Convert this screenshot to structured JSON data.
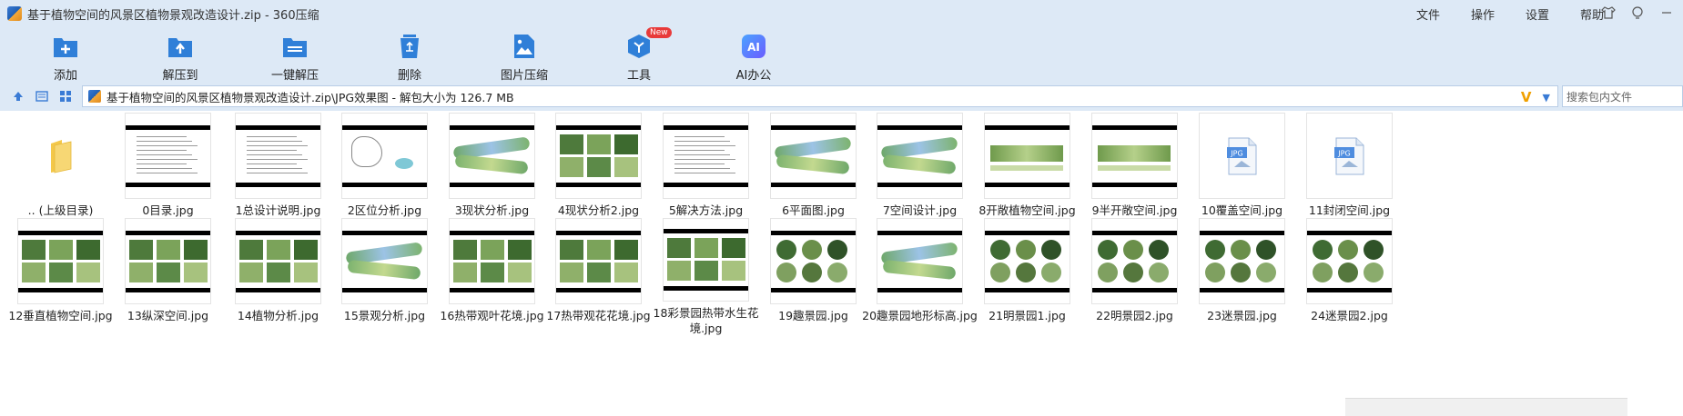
{
  "window": {
    "title": "基于植物空间的风景区植物景观改造设计.zip - 360压缩",
    "menu": [
      "文件",
      "操作",
      "设置",
      "帮助"
    ],
    "controls": [
      "skin-icon",
      "minimize-icon",
      "maximize-icon",
      "close-icon"
    ]
  },
  "toolbar": {
    "items": [
      {
        "label": "添加",
        "icon": "add-archive-icon",
        "color": "#2f7fd8"
      },
      {
        "label": "解压到",
        "icon": "extract-to-icon",
        "color": "#2f7fd8"
      },
      {
        "label": "一键解压",
        "icon": "one-click-extract-icon",
        "color": "#2f7fd8"
      },
      {
        "label": "删除",
        "icon": "recycle-icon",
        "color": "#2f7fd8"
      },
      {
        "label": "图片压缩",
        "icon": "image-compress-icon",
        "color": "#2f7fd8"
      },
      {
        "label": "工具",
        "icon": "tools-cube-icon",
        "color": "#2f7fd8",
        "badge": "New"
      },
      {
        "label": "AI办公",
        "icon": "ai-office-icon",
        "color": "#3b82f6"
      }
    ]
  },
  "address": {
    "path": "基于植物空间的风景区植物景观改造设计.zip\\JPG效果图 - 解包大小为 126.7 MB",
    "search_placeholder": "搜索包内文件"
  },
  "files": [
    {
      "name": ".. (上级目录)",
      "kind": "folder"
    },
    {
      "name": "0目录.jpg",
      "kind": "doc"
    },
    {
      "name": "1总设计说明.jpg",
      "kind": "doc"
    },
    {
      "name": "2区位分析.jpg",
      "kind": "map"
    },
    {
      "name": "3现状分析.jpg",
      "kind": "plan"
    },
    {
      "name": "4现状分析2.jpg",
      "kind": "photos"
    },
    {
      "name": "5解决方法.jpg",
      "kind": "doc"
    },
    {
      "name": "6平面图.jpg",
      "kind": "plan"
    },
    {
      "name": "7空间设计.jpg",
      "kind": "plan"
    },
    {
      "name": "8开敞植物空间.jpg",
      "kind": "section"
    },
    {
      "name": "9半开敞空间.jpg",
      "kind": "section"
    },
    {
      "name": "10覆盖空间.jpg",
      "kind": "jpg"
    },
    {
      "name": "11封闭空间.jpg",
      "kind": "jpg"
    },
    {
      "name": "12垂直植物空间.jpg",
      "kind": "photos"
    },
    {
      "name": "13纵深空间.jpg",
      "kind": "photos"
    },
    {
      "name": "14植物分析.jpg",
      "kind": "photos"
    },
    {
      "name": "15景观分析.jpg",
      "kind": "plan"
    },
    {
      "name": "16热带观叶花境.jpg",
      "kind": "photos"
    },
    {
      "name": "17热带观花花境.jpg",
      "kind": "photos"
    },
    {
      "name": "18彩景园热带水生花境.jpg",
      "kind": "photos"
    },
    {
      "name": "19趣景园.jpg",
      "kind": "circles"
    },
    {
      "name": "20趣景园地形标高.jpg",
      "kind": "plan"
    },
    {
      "name": "21明景园1.jpg",
      "kind": "circles"
    },
    {
      "name": "22明景园2.jpg",
      "kind": "circles"
    },
    {
      "name": "23迷景园.jpg",
      "kind": "circles"
    },
    {
      "name": "24迷景园2.jpg",
      "kind": "circles"
    }
  ]
}
